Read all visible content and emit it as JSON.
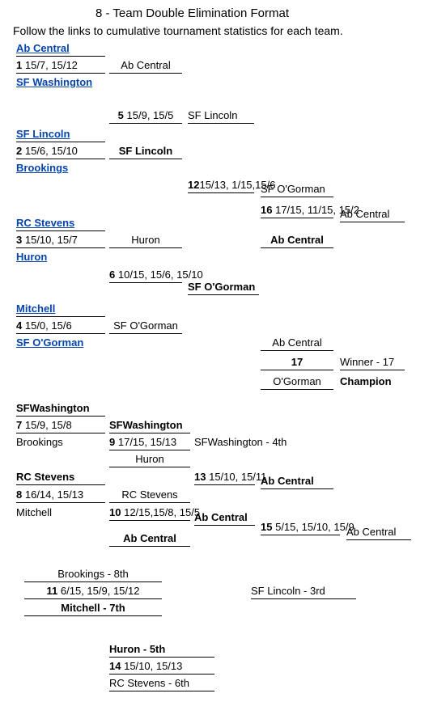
{
  "header": {
    "title": "8 - Team Double Elimination Format",
    "subtitle": "Follow the links to cumulative tournament statistics for each team."
  },
  "teams": {
    "ab_central": "Ab Central",
    "sf_washington": "SF Washington",
    "sf_lincoln": "SF Lincoln",
    "brookings": "Brookings",
    "rc_stevens": "RC Stevens",
    "huron": "Huron",
    "mitchell": "Mitchell",
    "sf_ogorman": "SF O'Gorman"
  },
  "winners": {
    "m1": {
      "num": "1",
      "score": "15/7, 15/12",
      "adv": "Ab Central"
    },
    "m2": {
      "num": "2",
      "score": "15/6, 15/10",
      "adv": "SF Lincoln"
    },
    "m3": {
      "num": "3",
      "score": "15/10, 15/7",
      "adv": "Huron"
    },
    "m4": {
      "num": "4",
      "score": "15/0, 15/6",
      "adv": "SF O'Gorman"
    },
    "m5": {
      "num": "5",
      "score": "15/9, 15/5",
      "adv": "SF Lincoln"
    },
    "m6": {
      "num": "6",
      "score": "10/15, 15/6, 15/10",
      "adv": "SF O'Gorman"
    },
    "m12": {
      "num": "12",
      "score": "15/13, 1/15,15/6",
      "adv": "SF O'Gorman"
    },
    "m16": {
      "num": "16",
      "score": "17/15, 11/15, 15/2",
      "adv_top": "Ab Central",
      "adv_bottom": "Ab Central"
    },
    "m17": {
      "num": "17",
      "top": "Ab Central",
      "bottom": "O'Gorman",
      "winner_label": "Winner - 17",
      "champion": "Champion"
    }
  },
  "losers": {
    "l7_top": "SFWashington",
    "l7": {
      "num": "7",
      "score": "15/9, 15/8",
      "adv": "SFWashington"
    },
    "l7_bottom": "Brookings",
    "l9": {
      "num": "9",
      "score": "17/15, 15/13",
      "adv": "SFWashington - 4th"
    },
    "l9_mid": "Huron",
    "l8_top": "RC Stevens",
    "l8": {
      "num": "8",
      "score": "16/14, 15/13",
      "adv": "RC Stevens"
    },
    "l8_bottom": "Mitchell",
    "l10": {
      "num": "10",
      "score": "12/15,15/8, 15/5",
      "adv": "Ab Central",
      "mid": "Ab Central"
    },
    "l13": {
      "num": "13",
      "score": "15/10, 15/11",
      "adv": "Ab Central"
    },
    "l15": {
      "num": "15",
      "score": "5/15, 15/10, 15/9",
      "adv": "Ab Central"
    }
  },
  "placement": {
    "p8": "Brookings - 8th",
    "m11": {
      "num": "11",
      "score": "6/15, 15/9, 15/12"
    },
    "p7": "Mitchell - 7th",
    "p3": "SF Lincoln - 3rd",
    "p5": "Huron - 5th",
    "m14": {
      "num": "14",
      "score": "15/10, 15/13"
    },
    "p6": "RC Stevens - 6th"
  }
}
